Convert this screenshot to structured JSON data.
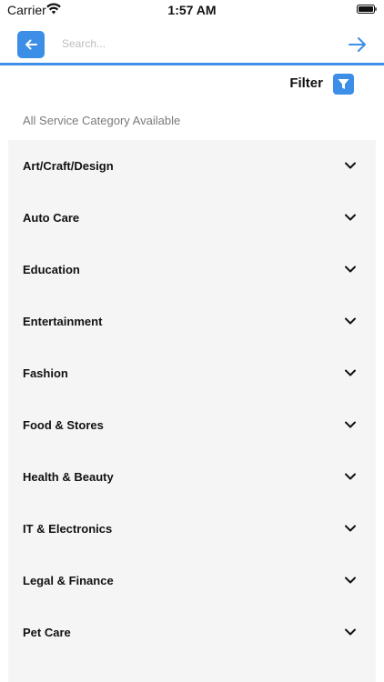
{
  "status_bar": {
    "carrier": "Carrier",
    "time": "1:57 AM"
  },
  "search": {
    "placeholder": "Search...",
    "value": ""
  },
  "filter": {
    "label": "Filter"
  },
  "section": {
    "title": "All Service Category Available"
  },
  "categories": [
    {
      "label": "Art/Craft/Design"
    },
    {
      "label": "Auto Care"
    },
    {
      "label": "Education"
    },
    {
      "label": "Entertainment"
    },
    {
      "label": "Fashion"
    },
    {
      "label": "Food & Stores"
    },
    {
      "label": "Health & Beauty"
    },
    {
      "label": "IT & Electronics"
    },
    {
      "label": "Legal & Finance"
    },
    {
      "label": "Pet Care"
    }
  ],
  "colors": {
    "accent": "#3d8ee6",
    "list_background": "#f5f5f5",
    "section_title": "#7a7a7a"
  },
  "icons": {
    "back": "arrow-left-icon",
    "go": "arrow-right-icon",
    "filter": "funnel-icon",
    "expand": "chevron-down-icon"
  }
}
